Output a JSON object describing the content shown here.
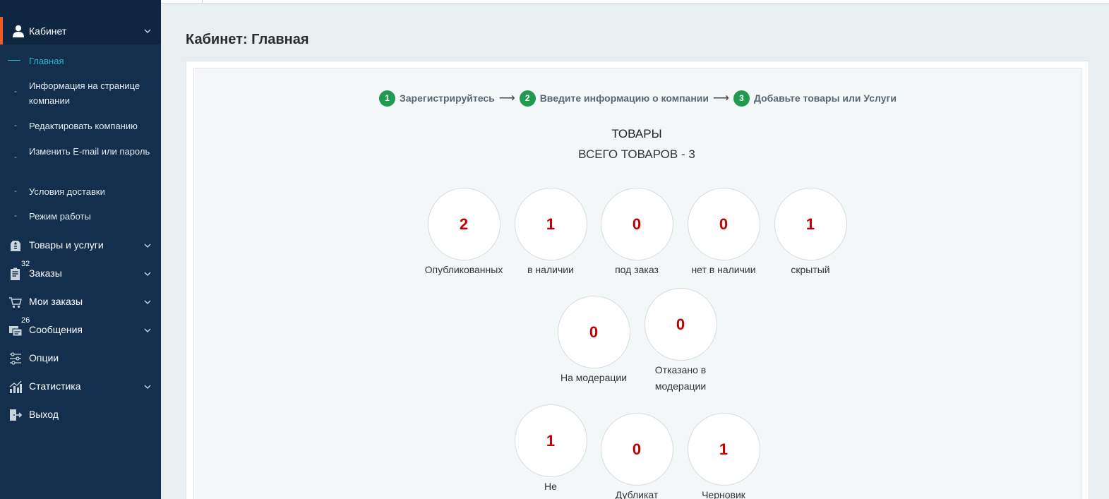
{
  "sidebar": {
    "head": {
      "label": "Кабинет"
    },
    "subitems": [
      {
        "label": "Главная",
        "active": true
      },
      {
        "label": "Информация на странице компании"
      },
      {
        "label": "Редактировать компанию"
      },
      {
        "label": "Изменить E-mail или пароль"
      },
      {
        "label": "Условия доставки"
      },
      {
        "label": "Режим работы"
      }
    ],
    "items": [
      {
        "label": "Товары и услуги",
        "icon": "tag-icon"
      },
      {
        "label": "Заказы",
        "icon": "orders-icon",
        "badge": "32"
      },
      {
        "label": "Мои заказы",
        "icon": "cart-icon"
      },
      {
        "label": "Сообщения",
        "icon": "messages-icon",
        "badge": "26"
      },
      {
        "label": "Опции",
        "icon": "sliders-icon"
      },
      {
        "label": "Статистика",
        "icon": "chart-icon"
      },
      {
        "label": "Выход",
        "icon": "exit-icon"
      }
    ]
  },
  "page": {
    "title": "Кабинет: Главная"
  },
  "steps": [
    {
      "num": "1",
      "label": "Зарегистрируйтесь"
    },
    {
      "num": "2",
      "label": "Введите информацию о компании"
    },
    {
      "num": "3",
      "label": "Добавьте товары или Услуги"
    }
  ],
  "arrow": "⟶",
  "goods": {
    "title": "ТОВАРЫ",
    "total": "ВСЕГО ТОВАРОВ - 3",
    "stats": [
      {
        "value": "2",
        "label": "Опубликованных"
      },
      {
        "value": "1",
        "label": "в наличии"
      },
      {
        "value": "0",
        "label": "под заказ"
      },
      {
        "value": "0",
        "label": "нет в наличии"
      },
      {
        "value": "1",
        "label": "скрытый"
      },
      {
        "value": "0",
        "label": "На модерации"
      },
      {
        "value": "0",
        "label": "Отказано в модерации"
      },
      {
        "value": "1",
        "label": "Не"
      },
      {
        "value": "0",
        "label": "Дубликат"
      },
      {
        "value": "1",
        "label": "Черновик"
      }
    ]
  },
  "colors": {
    "sidebar": "#132f4d",
    "accent": "#f15a24",
    "active": "#29b6c9",
    "step": "#1f9a50",
    "value": "#c00000"
  }
}
